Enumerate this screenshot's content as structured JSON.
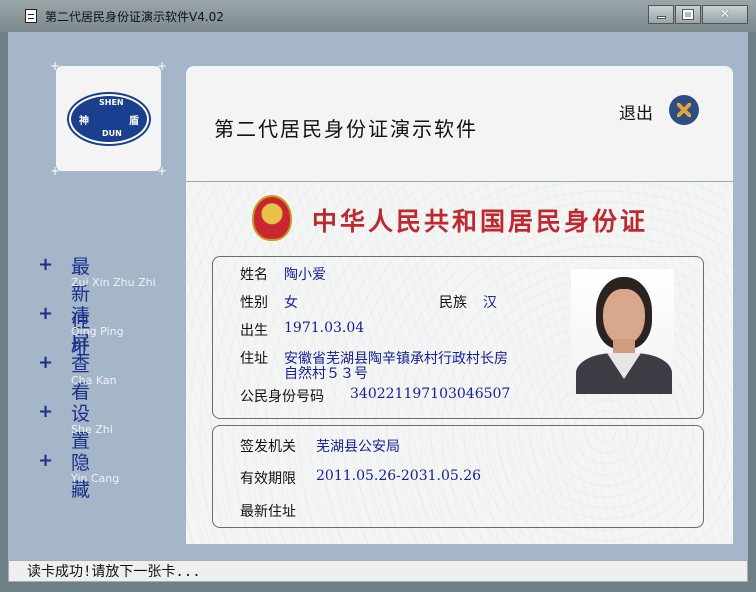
{
  "window": {
    "title": "第二代居民身份证演示软件V4.02"
  },
  "logo": {
    "text_top": "SHEN",
    "text_bottom": "DUN",
    "text_left": "神",
    "text_right": "盾"
  },
  "menu": [
    {
      "label": "最新住址",
      "pinyin": "Zui Xin Zhu Zhi"
    },
    {
      "label": "清屏",
      "pinyin": "Qing Ping"
    },
    {
      "label": "查看",
      "pinyin": "Cha Kan"
    },
    {
      "label": "设置",
      "pinyin": "She Zhi"
    },
    {
      "label": "隐藏",
      "pinyin": "Yin Cang"
    }
  ],
  "header": {
    "title": "第二代居民身份证演示软件",
    "exit_label": "退出"
  },
  "card": {
    "title": "中华人民共和国居民身份证",
    "name_label": "姓名",
    "name_value": "陶小爱",
    "gender_label": "性别",
    "gender_value": "女",
    "ethnicity_label": "民族",
    "ethnicity_value": "汉",
    "birth_label": "出生",
    "birth_value": "1971.03.04",
    "address_label": "住址",
    "address_line1": "安徽省芜湖县陶辛镇承村行政村长房",
    "address_line2": "自然村５３号",
    "id_label": "公民身份号码",
    "id_value": "340221197103046507",
    "authority_label": "签发机关",
    "authority_value": "芜湖县公安局",
    "validity_label": "有效期限",
    "validity_value": "2011.05.26-2031.05.26",
    "latest_address_label": "最新住址"
  },
  "status": {
    "text": "读卡成功!请放下一张卡..."
  },
  "colors": {
    "sidebar_bg": "#a5b6c8",
    "menu_text": "#1c2f8c",
    "card_title": "#c0282e",
    "value_text": "#1620a0"
  }
}
